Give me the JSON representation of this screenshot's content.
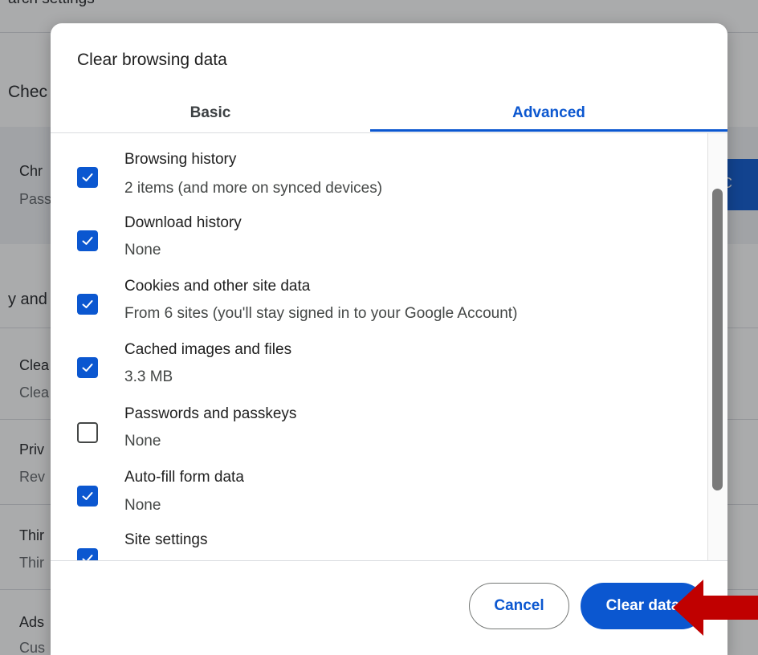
{
  "background": {
    "top_text": "arch settings",
    "check_label": "Chec",
    "card_line1": "Chr",
    "card_line2": "Pass",
    "card_button": "ty C",
    "section_label": "y and",
    "rows": [
      {
        "title": "Clea",
        "sub": "Clea"
      },
      {
        "title": "Priv",
        "sub": "Rev"
      },
      {
        "title": "Thir",
        "sub": "Thir"
      },
      {
        "title": "Ads",
        "sub": "Cus"
      }
    ]
  },
  "dialog": {
    "title": "Clear browsing data",
    "tabs": [
      {
        "label": "Basic",
        "active": false
      },
      {
        "label": "Advanced",
        "active": true
      }
    ],
    "items": [
      {
        "title": "Browsing history",
        "sub": "2 items (and more on synced devices)",
        "checked": true
      },
      {
        "title": "Download history",
        "sub": "None",
        "checked": true
      },
      {
        "title": "Cookies and other site data",
        "sub": "From 6 sites (you'll stay signed in to your Google Account)",
        "checked": true
      },
      {
        "title": "Cached images and files",
        "sub": "3.3 MB",
        "checked": true
      },
      {
        "title": "Passwords and passkeys",
        "sub": "None",
        "checked": false
      },
      {
        "title": "Auto-fill form data",
        "sub": "None",
        "checked": true
      },
      {
        "title": "Site settings",
        "sub": "",
        "checked": true
      }
    ],
    "cancel_label": "Cancel",
    "clear_label": "Clear data"
  },
  "colors": {
    "accent": "#0b57d0",
    "arrow": "#c00000"
  },
  "icons": {
    "checkmark": "checkmark-icon",
    "annotation_arrow": "arrow-left-icon"
  }
}
